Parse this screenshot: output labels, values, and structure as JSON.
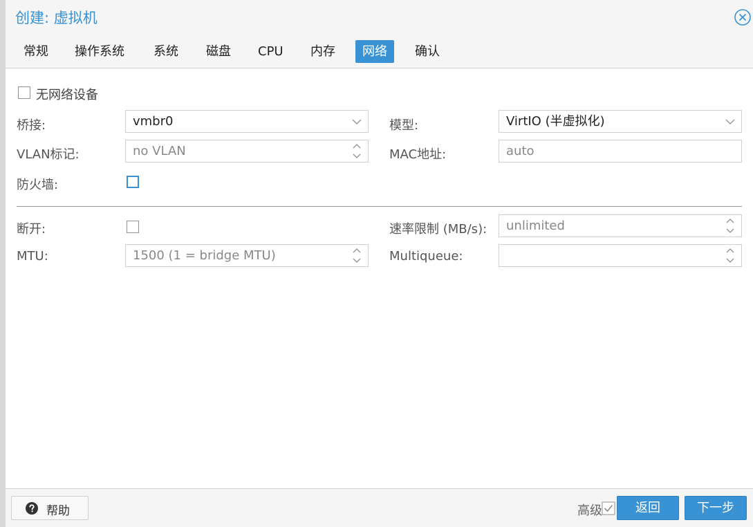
{
  "dialog": {
    "title": "创建: 虚拟机"
  },
  "tabs": [
    {
      "label": "常规",
      "active": false
    },
    {
      "label": "操作系统",
      "active": false
    },
    {
      "label": "系统",
      "active": false
    },
    {
      "label": "磁盘",
      "active": false
    },
    {
      "label": "CPU",
      "active": false
    },
    {
      "label": "内存",
      "active": false
    },
    {
      "label": "网络",
      "active": true
    },
    {
      "label": "确认",
      "active": false
    }
  ],
  "form": {
    "no_network": {
      "label": "无网络设备",
      "checked": false
    },
    "bridge": {
      "label": "桥接:",
      "value": "vmbr0"
    },
    "model": {
      "label": "模型:",
      "value": "VirtIO (半虚拟化)"
    },
    "vlan": {
      "label": "VLAN标记:",
      "placeholder": "no VLAN"
    },
    "mac": {
      "label": "MAC地址:",
      "placeholder": "auto"
    },
    "firewall": {
      "label": "防火墙:",
      "checked": false
    },
    "disconnect": {
      "label": "断开:",
      "checked": false
    },
    "rate_limit": {
      "label": "速率限制 (MB/s):",
      "placeholder": "unlimited"
    },
    "mtu": {
      "label": "MTU:",
      "placeholder": "1500 (1 = bridge MTU)"
    },
    "multiqueue": {
      "label": "Multiqueue:",
      "value": ""
    }
  },
  "footer": {
    "help_label": "帮助",
    "advanced_label": "高级",
    "advanced_checked": true,
    "back_label": "返回",
    "next_label": "下一步"
  },
  "colors": {
    "accent": "#3892d4"
  }
}
